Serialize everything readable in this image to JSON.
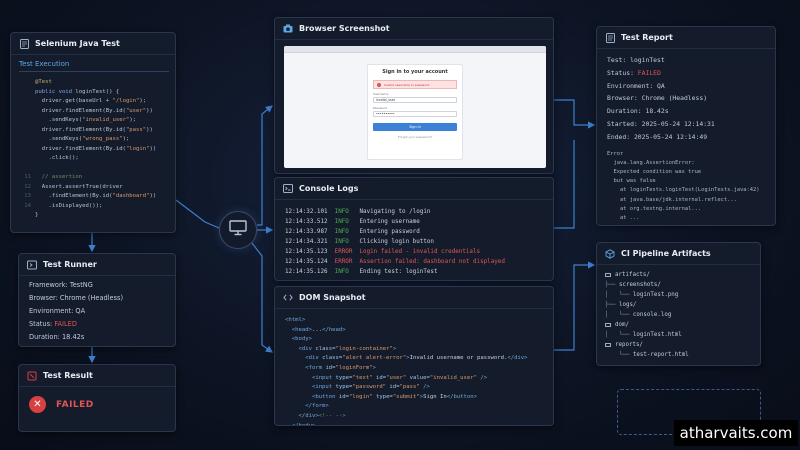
{
  "selenium": {
    "title": "Selenium Java Test",
    "subtab": "Test Execution",
    "lines": [
      {
        "n": "",
        "segs": [
          {
            "t": "@Test",
            "c": "ann"
          }
        ]
      },
      {
        "n": "",
        "segs": [
          {
            "t": "public void ",
            "c": "kw"
          },
          {
            "t": "loginTest() {",
            "c": ""
          }
        ]
      },
      {
        "n": "",
        "segs": [
          {
            "t": "  driver.get(baseUrl + ",
            "c": ""
          },
          {
            "t": "\"/login\"",
            "c": "str"
          },
          {
            "t": ");",
            "c": ""
          }
        ]
      },
      {
        "n": "",
        "segs": [
          {
            "t": "  driver.findElement(By.id(",
            "c": ""
          },
          {
            "t": "\"user\"",
            "c": "str"
          },
          {
            "t": "))",
            "c": ""
          }
        ]
      },
      {
        "n": "",
        "segs": [
          {
            "t": "    .sendKeys(",
            "c": ""
          },
          {
            "t": "\"invalid_user\"",
            "c": "str"
          },
          {
            "t": ");",
            "c": ""
          }
        ]
      },
      {
        "n": "",
        "segs": [
          {
            "t": "  driver.findElement(By.id(",
            "c": ""
          },
          {
            "t": "\"pass\"",
            "c": "str"
          },
          {
            "t": "))",
            "c": ""
          }
        ]
      },
      {
        "n": "",
        "segs": [
          {
            "t": "    .sendKeys(",
            "c": ""
          },
          {
            "t": "\"wrong_pass\"",
            "c": "str"
          },
          {
            "t": ");",
            "c": ""
          }
        ]
      },
      {
        "n": "",
        "segs": [
          {
            "t": "  driver.findElement(By.id(",
            "c": ""
          },
          {
            "t": "\"login\"",
            "c": "str"
          },
          {
            "t": "))",
            "c": ""
          }
        ]
      },
      {
        "n": "",
        "segs": [
          {
            "t": "    .click();",
            "c": ""
          }
        ]
      },
      {
        "n": "",
        "segs": [
          {
            "t": "",
            "c": ""
          }
        ]
      },
      {
        "n": "11",
        "segs": [
          {
            "t": "  // assertion",
            "c": "cm"
          }
        ]
      },
      {
        "n": "12",
        "segs": [
          {
            "t": "  Assert.assertTrue(driver",
            "c": ""
          }
        ]
      },
      {
        "n": "13",
        "segs": [
          {
            "t": "    .findElement(By.id(",
            "c": ""
          },
          {
            "t": "\"dashboard\"",
            "c": "str"
          },
          {
            "t": "))",
            "c": ""
          }
        ]
      },
      {
        "n": "14",
        "segs": [
          {
            "t": "    .isDisplayed());",
            "c": ""
          }
        ]
      },
      {
        "n": "",
        "segs": [
          {
            "t": "}",
            "c": ""
          }
        ]
      }
    ]
  },
  "runner": {
    "title": "Test Runner",
    "rows": [
      {
        "label": "Framework: ",
        "value": "TestNG",
        "c": ""
      },
      {
        "label": "Browser: ",
        "value": "Chrome (Headless)",
        "c": ""
      },
      {
        "label": "Environment: ",
        "value": "QA",
        "c": ""
      },
      {
        "label": "Status: ",
        "value": "FAILED",
        "c": "red"
      },
      {
        "label": "Duration: ",
        "value": "18.42s",
        "c": ""
      }
    ]
  },
  "result": {
    "title": "Test Result",
    "status": "FAILED",
    "icon": "✕"
  },
  "browser": {
    "title": "Browser Screenshot",
    "login_title": "Sign in to your account",
    "alert_text": "Invalid username or password.",
    "username_label": "Username",
    "username_value": "invalid_user",
    "password_label": "Password",
    "password_value": "••••••••••",
    "button_label": "Sign in",
    "forgot_label": "Forgot your password?"
  },
  "console": {
    "title": "Console Logs",
    "lines": [
      {
        "time": "12:14:32.101",
        "level": "INFO",
        "msg": "Navigating to /login",
        "c": "green"
      },
      {
        "time": "12:14:33.512",
        "level": "INFO",
        "msg": "Entering username",
        "c": "green"
      },
      {
        "time": "12:14:33.987",
        "level": "INFO",
        "msg": "Entering password",
        "c": "green"
      },
      {
        "time": "12:14:34.321",
        "level": "INFO",
        "msg": "Clicking login button",
        "c": "green"
      },
      {
        "time": "12:14:35.123",
        "level": "ERROR",
        "msg": "Login failed - invalid credentials",
        "c": "red"
      },
      {
        "time": "12:14:35.124",
        "level": "ERROR",
        "msg": "Assertion failed: dashboard not displayed",
        "c": "red"
      },
      {
        "time": "12:14:35.126",
        "level": "INFO",
        "msg": "Ending test: loginTest",
        "c": "green"
      }
    ]
  },
  "dom": {
    "title": "DOM Snapshot",
    "lines": [
      {
        "indent": 0,
        "segs": [
          {
            "t": "<html>",
            "c": "tag"
          }
        ]
      },
      {
        "indent": 1,
        "segs": [
          {
            "t": "<head>",
            "c": "tag"
          },
          {
            "t": "...",
            "c": ""
          },
          {
            "t": "</head>",
            "c": "tag"
          }
        ]
      },
      {
        "indent": 1,
        "segs": [
          {
            "t": "<body>",
            "c": "tag"
          }
        ]
      },
      {
        "indent": 2,
        "segs": [
          {
            "t": "<div ",
            "c": "tag"
          },
          {
            "t": "class=",
            "c": "attr"
          },
          {
            "t": "\"login-container\"",
            "c": "val"
          },
          {
            "t": ">",
            "c": "tag"
          }
        ]
      },
      {
        "indent": 3,
        "segs": [
          {
            "t": "<div ",
            "c": "tag"
          },
          {
            "t": "class=",
            "c": "attr"
          },
          {
            "t": "\"alert alert-error\"",
            "c": "val"
          },
          {
            "t": ">",
            "c": "tag"
          },
          {
            "t": "Invalid username or password.",
            "c": ""
          },
          {
            "t": "</div>",
            "c": "tag"
          }
        ]
      },
      {
        "indent": 3,
        "segs": [
          {
            "t": "<form ",
            "c": "tag"
          },
          {
            "t": "id=",
            "c": "attr"
          },
          {
            "t": "\"loginForm\"",
            "c": "val"
          },
          {
            "t": ">",
            "c": "tag"
          }
        ]
      },
      {
        "indent": 4,
        "segs": [
          {
            "t": "<input ",
            "c": "tag"
          },
          {
            "t": "type=",
            "c": "attr"
          },
          {
            "t": "\"text\"",
            "c": "val"
          },
          {
            "t": " id=",
            "c": "attr"
          },
          {
            "t": "\"user\"",
            "c": "val"
          },
          {
            "t": " value=",
            "c": "attr"
          },
          {
            "t": "\"invalid_user\"",
            "c": "val"
          },
          {
            "t": " />",
            "c": "tag"
          }
        ]
      },
      {
        "indent": 4,
        "segs": [
          {
            "t": "<input ",
            "c": "tag"
          },
          {
            "t": "type=",
            "c": "attr"
          },
          {
            "t": "\"password\"",
            "c": "val"
          },
          {
            "t": " id=",
            "c": "attr"
          },
          {
            "t": "\"pass\"",
            "c": "val"
          },
          {
            "t": " />",
            "c": "tag"
          }
        ]
      },
      {
        "indent": 4,
        "segs": [
          {
            "t": "<button ",
            "c": "tag"
          },
          {
            "t": "id=",
            "c": "attr"
          },
          {
            "t": "\"login\"",
            "c": "val"
          },
          {
            "t": " type=",
            "c": "attr"
          },
          {
            "t": "\"submit\"",
            "c": "val"
          },
          {
            "t": ">",
            "c": "tag"
          },
          {
            "t": "Sign In",
            "c": ""
          },
          {
            "t": "</button>",
            "c": "tag"
          }
        ]
      },
      {
        "indent": 3,
        "segs": [
          {
            "t": "</form>",
            "c": "tag"
          }
        ]
      },
      {
        "indent": 2,
        "segs": [
          {
            "t": "</div>",
            "c": "tag"
          },
          {
            "t": "<!-- -->",
            "c": "cm"
          }
        ]
      },
      {
        "indent": 1,
        "segs": [
          {
            "t": "</body>",
            "c": "tag"
          }
        ]
      },
      {
        "indent": 0,
        "segs": [
          {
            "t": "</html>",
            "c": "tag"
          }
        ]
      }
    ]
  },
  "report": {
    "title": "Test Report",
    "rows": [
      {
        "label": "Test: ",
        "value": "loginTest",
        "c": ""
      },
      {
        "label": "Status: ",
        "value": "FAILED",
        "c": "red"
      },
      {
        "label": "Environment: ",
        "value": "QA",
        "c": ""
      },
      {
        "label": "Browser: ",
        "value": "Chrome (Headless)",
        "c": ""
      },
      {
        "label": "Duration: ",
        "value": "18.42s",
        "c": ""
      },
      {
        "label": "Started: ",
        "value": "2025-05-24 12:14:31",
        "c": ""
      },
      {
        "label": "Ended: ",
        "value": "2025-05-24 12:14:49",
        "c": ""
      }
    ],
    "error_heading": "Error",
    "error_lines": [
      "  java.lang.AssertionError:",
      "  Expected condition was true",
      "  but was false",
      "    at loginTests.loginTest(LoginTests.java:42)",
      "    at java.base/jdk.internal.reflect...",
      "    at org.testng.internal...",
      "    at ..."
    ]
  },
  "artifacts": {
    "title": "CI Pipeline Artifacts",
    "lines": [
      {
        "prefix": "",
        "name": "artifacts/",
        "folder": true
      },
      {
        "prefix": "├── ",
        "name": "screenshots/",
        "folder": false
      },
      {
        "prefix": "│   └── ",
        "name": "loginTest.png",
        "folder": false
      },
      {
        "prefix": "├── ",
        "name": "logs/",
        "folder": false
      },
      {
        "prefix": "│   └── ",
        "name": "console.log",
        "folder": false
      },
      {
        "prefix": "",
        "name": "dom/",
        "folder": true
      },
      {
        "prefix": "│   └── ",
        "name": "loginTest.html",
        "folder": false
      },
      {
        "prefix": "",
        "name": "reports/",
        "folder": true
      },
      {
        "prefix": "    └── ",
        "name": "test-report.html",
        "folder": false
      }
    ]
  },
  "watermark": "atharvaits.com",
  "colors": {
    "accent": "#4a90d9",
    "fail": "#e05454",
    "info": "#4caf50"
  }
}
